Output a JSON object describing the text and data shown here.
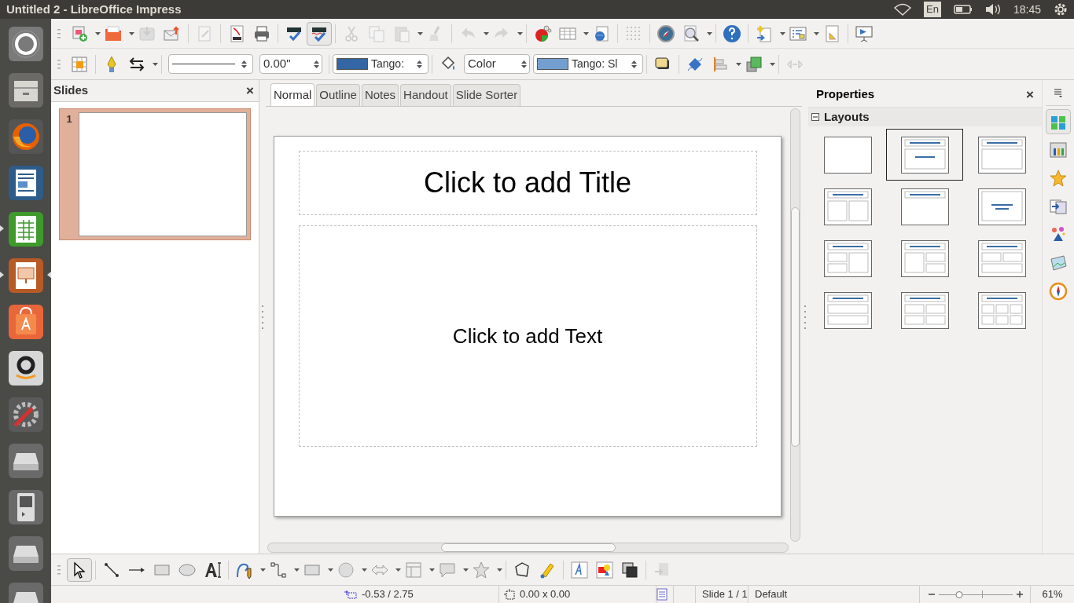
{
  "top_panel": {
    "title": "Untitled 2 - LibreOffice Impress",
    "keyboard": "En",
    "time": "18:45"
  },
  "launcher": [
    {
      "running": false,
      "focused": false
    },
    {
      "running": false,
      "focused": false
    },
    {
      "running": false,
      "focused": false
    },
    {
      "running": false,
      "focused": false
    },
    {
      "running": true,
      "focused": false
    },
    {
      "running": true,
      "focused": true
    },
    {
      "running": false,
      "focused": false
    },
    {
      "running": false,
      "focused": false
    },
    {
      "running": false,
      "focused": false
    },
    {
      "running": false,
      "focused": false
    },
    {
      "running": false,
      "focused": false
    },
    {
      "running": false,
      "focused": false
    },
    {
      "running": false,
      "focused": false
    }
  ],
  "standard_toolbar": {
    "auto_spellcheck": {
      "on": true
    }
  },
  "line_and_filling_toolbar": {
    "line_width": "0.00\"",
    "line_color": "Tango:",
    "area_style": "Color",
    "area_color": "Tango: Sl"
  },
  "slides_pane": {
    "title": "Slides",
    "close": "×",
    "slides": [
      {
        "number": "1",
        "selected": true
      }
    ]
  },
  "view_tabs": [
    {
      "label": "Normal",
      "selected": true
    },
    {
      "label": "Outline",
      "selected": false
    },
    {
      "label": "Notes",
      "selected": false
    },
    {
      "label": "Handout",
      "selected": false
    },
    {
      "label": "Slide Sorter",
      "selected": false
    }
  ],
  "slide": {
    "title_placeholder": "Click to add Title",
    "text_placeholder": "Click to add Text"
  },
  "properties": {
    "title": "Properties",
    "close": "×",
    "section": {
      "title": "Layouts",
      "expanded": true
    },
    "layouts": [
      {
        "kind": "blank",
        "selected": false
      },
      {
        "kind": "title-content",
        "selected": true
      },
      {
        "kind": "title-box",
        "selected": false
      },
      {
        "kind": "title-2content",
        "selected": false
      },
      {
        "kind": "title-only",
        "selected": false
      },
      {
        "kind": "centered-text",
        "selected": false
      },
      {
        "kind": "title-2content-content",
        "selected": false
      },
      {
        "kind": "title-content-2content",
        "selected": false
      },
      {
        "kind": "title-2content-over-content",
        "selected": false
      },
      {
        "kind": "title-content-over-content",
        "selected": false
      },
      {
        "kind": "title-4content",
        "selected": false
      },
      {
        "kind": "title-6content",
        "selected": false
      }
    ]
  },
  "drawing_toolbar": {
    "select": {
      "on": true
    }
  },
  "status_bar": {
    "position": "-0.53 / 2.75",
    "size": "0.00 x 0.00",
    "slide": "Slide 1 / 1",
    "master": "Default",
    "zoom_slider": {
      "level": 0.28
    },
    "zoom": "61%"
  }
}
